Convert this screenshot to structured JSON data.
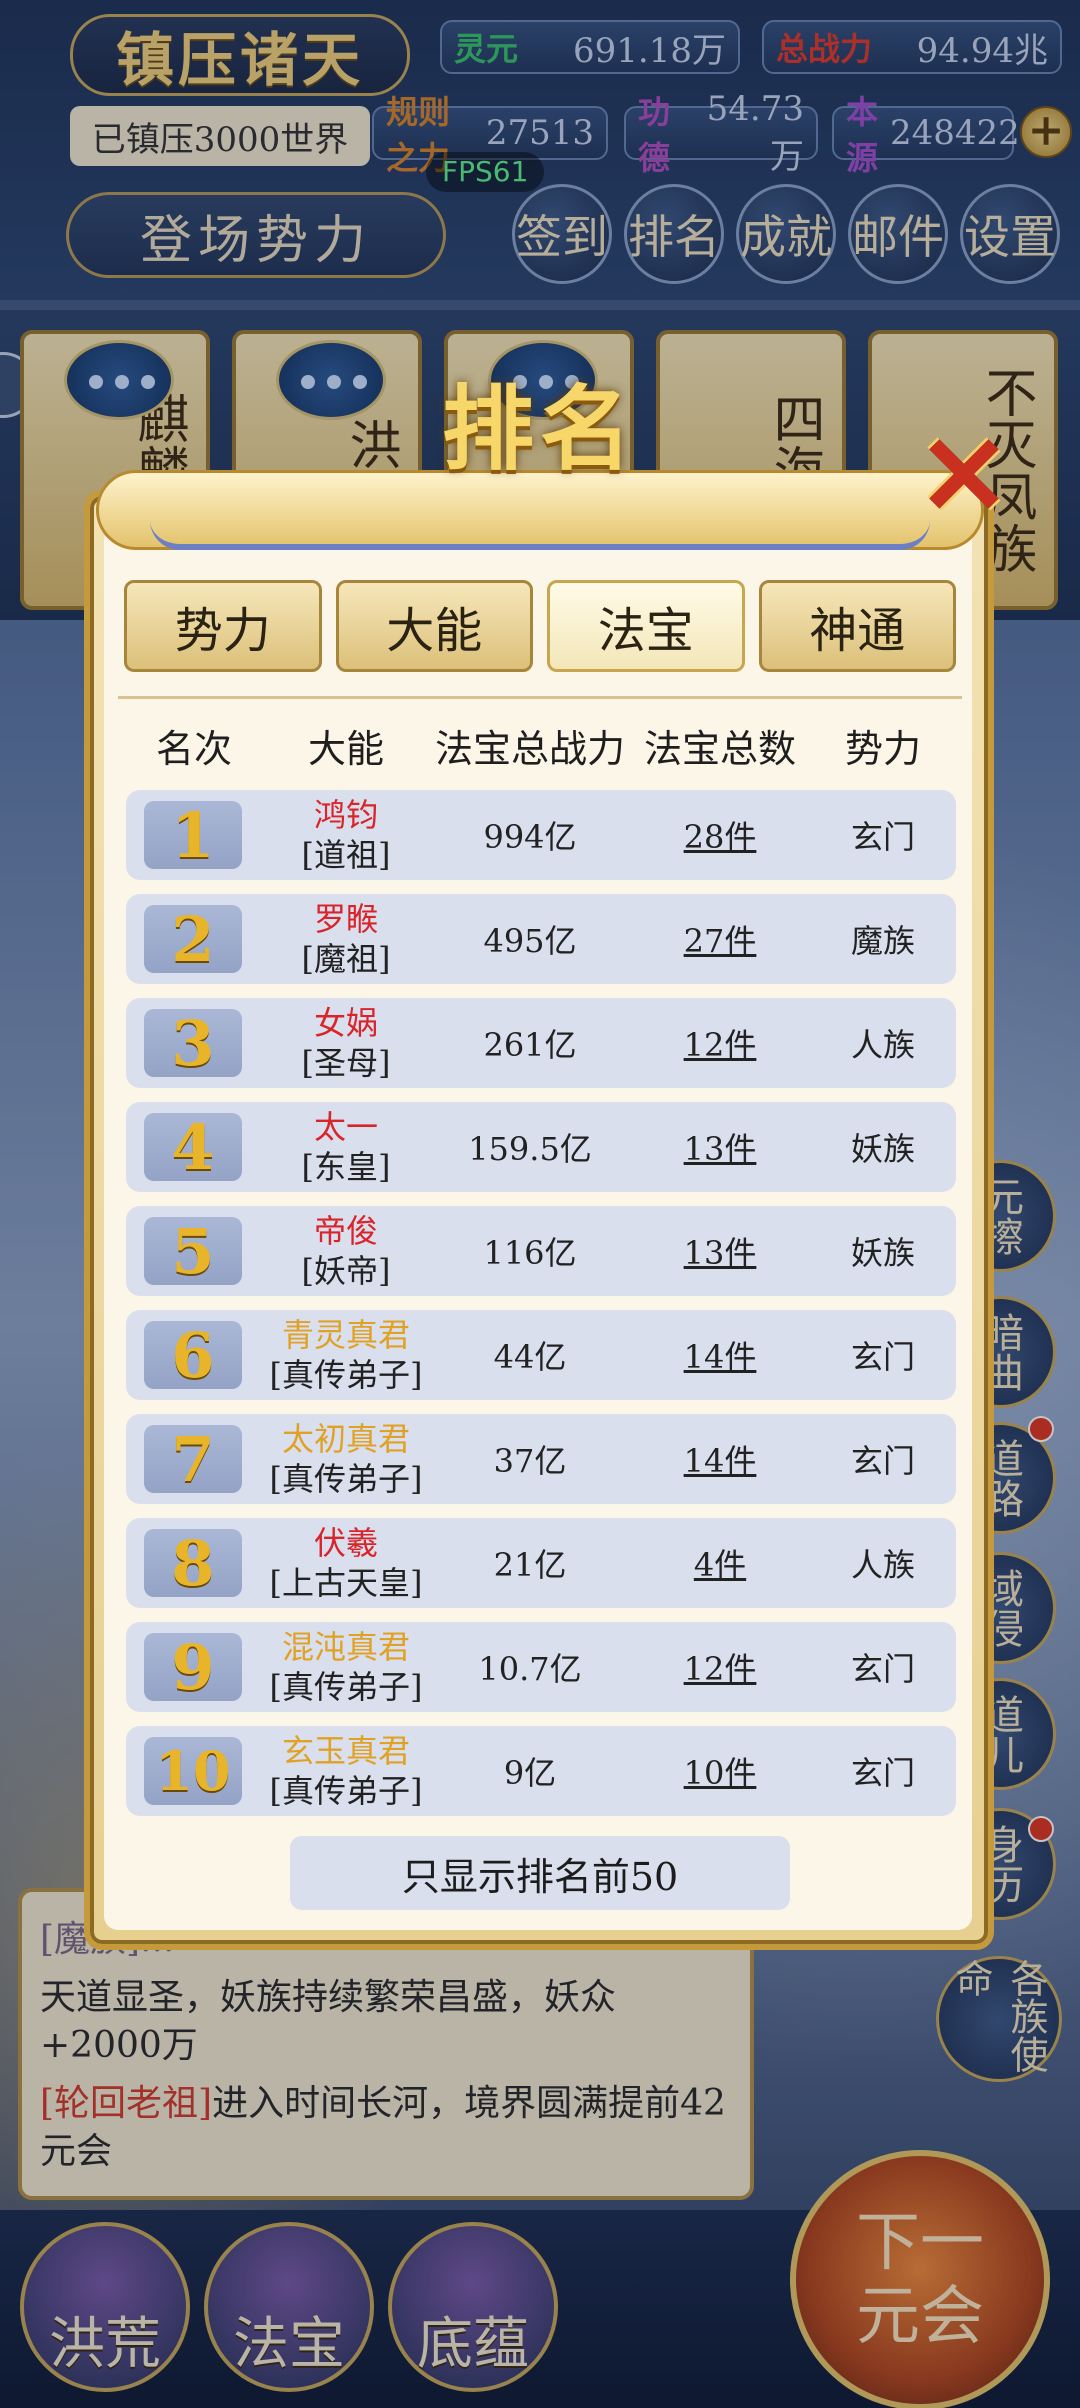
{
  "header": {
    "game_title": "镇压诸天",
    "subtitle": "已镇压3000世界",
    "fps": "FPS61",
    "stage_button": "登场势力",
    "resources": [
      {
        "label": "灵元",
        "value": "691.18万",
        "color": "#38c26a"
      },
      {
        "label": "总战力",
        "value": "94.94兆",
        "color": "#e2382a"
      },
      {
        "label": "规则之力",
        "value": "27513",
        "color": "#d9852a"
      },
      {
        "label": "功德",
        "value": "54.73万",
        "color": "#b34ec0"
      },
      {
        "label": "本源",
        "value": "248422",
        "color": "#a64fd0"
      }
    ],
    "plus_label": "+",
    "menu": [
      "签到",
      "排名",
      "成就",
      "邮件",
      "设置"
    ]
  },
  "cards": [
    "麒麟皇",
    "洪其",
    "",
    "四海龙",
    "不灭凤族"
  ],
  "side_buttons": [
    "元擦",
    "暗曲",
    "道路",
    "域侵",
    "道儿",
    "身历",
    "各族使命"
  ],
  "modal": {
    "title": "排名",
    "close_label": "✕",
    "tabs": [
      {
        "label": "势力",
        "active": false
      },
      {
        "label": "大能",
        "active": false
      },
      {
        "label": "法宝",
        "active": true
      },
      {
        "label": "神通",
        "active": false
      }
    ],
    "columns": [
      "名次",
      "大能",
      "法宝总战力",
      "法宝总数",
      "势力"
    ],
    "rows": [
      {
        "rank": "1",
        "name": "鸿钧",
        "name_color": "#d9252a",
        "title": "[道祖]",
        "power": "994亿",
        "count": "28件",
        "faction": "玄门"
      },
      {
        "rank": "2",
        "name": "罗睺",
        "name_color": "#d9252a",
        "title": "[魔祖]",
        "power": "495亿",
        "count": "27件",
        "faction": "魔族"
      },
      {
        "rank": "3",
        "name": "女娲",
        "name_color": "#d9252a",
        "title": "[圣母]",
        "power": "261亿",
        "count": "12件",
        "faction": "人族"
      },
      {
        "rank": "4",
        "name": "太一",
        "name_color": "#d9252a",
        "title": "[东皇]",
        "power": "159.5亿",
        "count": "13件",
        "faction": "妖族"
      },
      {
        "rank": "5",
        "name": "帝俊",
        "name_color": "#d9252a",
        "title": "[妖帝]",
        "power": "116亿",
        "count": "13件",
        "faction": "妖族"
      },
      {
        "rank": "6",
        "name": "青灵真君",
        "name_color": "#e0a226",
        "title": "[真传弟子]",
        "power": "44亿",
        "count": "14件",
        "faction": "玄门"
      },
      {
        "rank": "7",
        "name": "太初真君",
        "name_color": "#e0a226",
        "title": "[真传弟子]",
        "power": "37亿",
        "count": "14件",
        "faction": "玄门"
      },
      {
        "rank": "8",
        "name": "伏羲",
        "name_color": "#d9252a",
        "title": "[上古天皇]",
        "power": "21亿",
        "count": "4件",
        "faction": "人族"
      },
      {
        "rank": "9",
        "name": "混沌真君",
        "name_color": "#e0a226",
        "title": "[真传弟子]",
        "power": "10.7亿",
        "count": "12件",
        "faction": "玄门"
      },
      {
        "rank": "10",
        "name": "玄玉真君",
        "name_color": "#e0a226",
        "title": "[真传弟子]",
        "power": "9亿",
        "count": "10件",
        "faction": "玄门"
      }
    ],
    "footer_note": "只显示排名前50"
  },
  "log": {
    "line0": "[魔族]...",
    "line1": "天道显圣，妖族持续繁荣昌盛，妖众+2000万",
    "line2_name": "[轮回老祖]",
    "line2_rest": "进入时间长河，境界圆满提前42元会"
  },
  "bottom": {
    "buttons": [
      "洪荒",
      "法宝",
      "底蕴"
    ],
    "next_line1": "下一",
    "next_line2": "元会"
  }
}
